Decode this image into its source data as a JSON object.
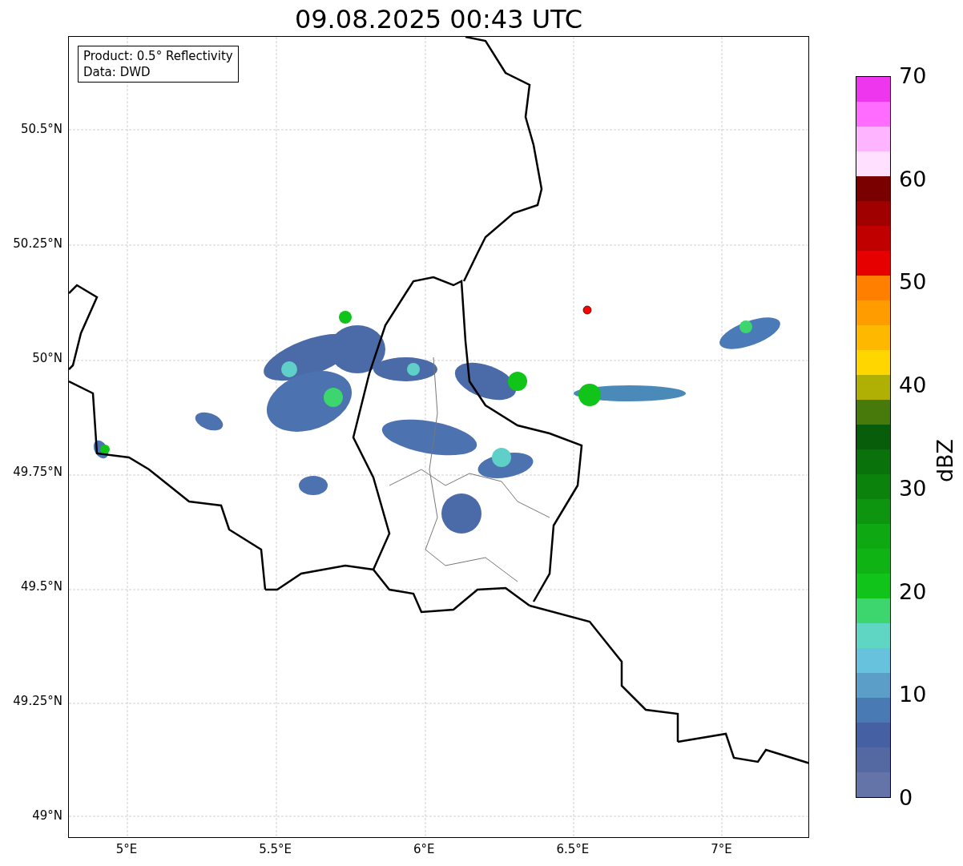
{
  "title": "09.08.2025 00:43 UTC",
  "legend": [
    "Product: 0.5° Reflectivity",
    "Data: DWD"
  ],
  "y_ticks": [
    "50.5°N",
    "50.25°N",
    "50°N",
    "49.75°N",
    "49.5°N",
    "49.25°N",
    "49°N"
  ],
  "x_ticks": [
    "5°E",
    "5.5°E",
    "6°E",
    "6.5°E",
    "7°E"
  ],
  "colorbar": {
    "label": "dBZ",
    "ticks": [
      "70",
      "60",
      "50",
      "40",
      "30",
      "20",
      "10",
      "0"
    ],
    "bins": [
      {
        "color": "#6574a8"
      },
      {
        "color": "#5469a1"
      },
      {
        "color": "#4660a4"
      },
      {
        "color": "#4a7ab3"
      },
      {
        "color": "#5b9fc8"
      },
      {
        "color": "#67c3dd"
      },
      {
        "color": "#5fd6c4"
      },
      {
        "color": "#3dd66e"
      },
      {
        "color": "#10c41a"
      },
      {
        "color": "#0fb314"
      },
      {
        "color": "#0ea812"
      },
      {
        "color": "#0d950f"
      },
      {
        "color": "#0b820c"
      },
      {
        "color": "#0a720b"
      },
      {
        "color": "#075d0a"
      },
      {
        "color": "#487a0b"
      },
      {
        "color": "#b0b004"
      },
      {
        "color": "#ffd600"
      },
      {
        "color": "#ffb800"
      },
      {
        "color": "#ff9c00"
      },
      {
        "color": "#ff8000"
      },
      {
        "color": "#e60000"
      },
      {
        "color": "#c00000"
      },
      {
        "color": "#a00000"
      },
      {
        "color": "#7a0000"
      },
      {
        "color": "#ffe0ff"
      },
      {
        "color": "#ffb4ff"
      },
      {
        "color": "#ff6cff"
      },
      {
        "color": "#ee36ee"
      }
    ]
  }
}
